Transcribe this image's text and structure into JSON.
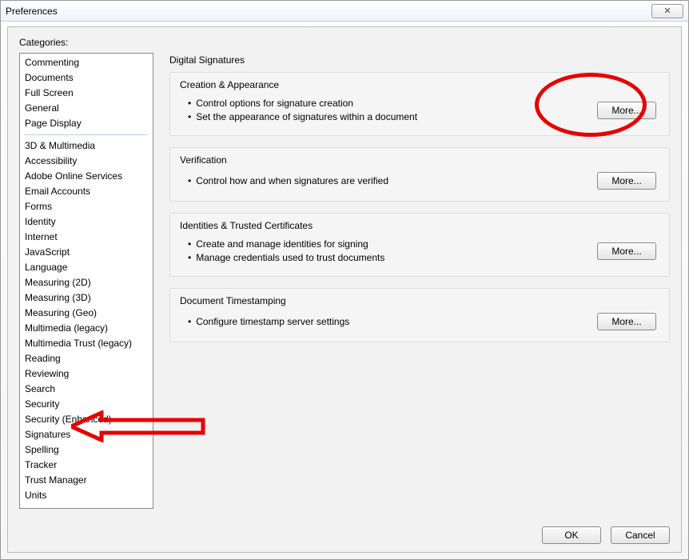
{
  "window": {
    "title": "Preferences",
    "close_glyph": "✕"
  },
  "categories_label": "Categories:",
  "categories_top": [
    "Commenting",
    "Documents",
    "Full Screen",
    "General",
    "Page Display"
  ],
  "categories_rest": [
    "3D & Multimedia",
    "Accessibility",
    "Adobe Online Services",
    "Email Accounts",
    "Forms",
    "Identity",
    "Internet",
    "JavaScript",
    "Language",
    "Measuring (2D)",
    "Measuring (3D)",
    "Measuring (Geo)",
    "Multimedia (legacy)",
    "Multimedia Trust (legacy)",
    "Reading",
    "Reviewing",
    "Search",
    "Security",
    "Security (Enhanced)",
    "Signatures",
    "Spelling",
    "Tracker",
    "Trust Manager",
    "Units"
  ],
  "pane": {
    "title": "Digital Signatures",
    "groups": [
      {
        "title": "Creation & Appearance",
        "bullets": [
          "Control options for signature creation",
          "Set the appearance of signatures within a document"
        ],
        "button": "More..."
      },
      {
        "title": "Verification",
        "bullets": [
          "Control how and when signatures are verified"
        ],
        "button": "More..."
      },
      {
        "title": "Identities & Trusted Certificates",
        "bullets": [
          "Create and manage identities for signing",
          "Manage credentials used to trust documents"
        ],
        "button": "More..."
      },
      {
        "title": "Document Timestamping",
        "bullets": [
          "Configure timestamp server settings"
        ],
        "button": "More..."
      }
    ]
  },
  "footer": {
    "ok": "OK",
    "cancel": "Cancel"
  }
}
